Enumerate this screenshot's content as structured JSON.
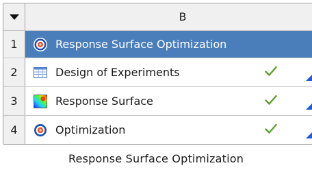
{
  "table": {
    "column_letter": "B",
    "header_icon": "collapse-arrow-icon",
    "rows": [
      {
        "number": "1",
        "label": "Response Surface Optimization",
        "icon": "response-surface-optimization-icon",
        "status": ""
      },
      {
        "number": "2",
        "label": "Design of Experiments",
        "icon": "design-of-experiments-icon",
        "status": "up-to-date-check-icon"
      },
      {
        "number": "3",
        "label": "Response Surface",
        "icon": "response-surface-icon",
        "status": "up-to-date-check-icon"
      },
      {
        "number": "4",
        "label": "Optimization",
        "icon": "optimization-icon",
        "status": "up-to-date-check-icon"
      }
    ]
  },
  "system_caption": "Response Surface Optimization",
  "colors": {
    "selected_row": "#4a7ebb",
    "check": "#5aa02c",
    "grid_border": "#a0a0a0",
    "header_bg": "#f0f0f0",
    "connector": "#1e5bd6"
  }
}
